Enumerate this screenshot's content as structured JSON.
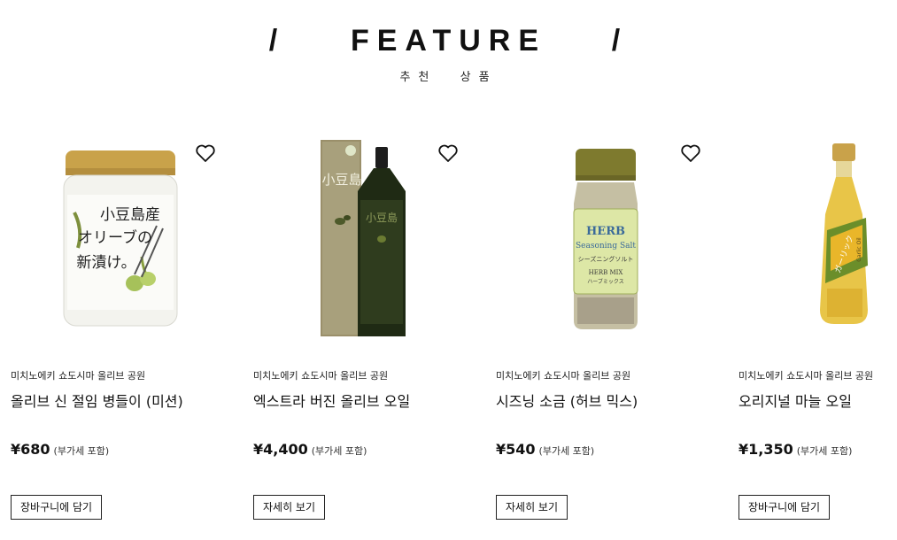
{
  "section": {
    "title": "/    FEATURE    /",
    "subtitle": "추천  상품"
  },
  "products": [
    {
      "brand": "미치노에키 쇼도시마 올리브 공원",
      "name": "올리브 신 절임 병들이 (미션)",
      "price": "¥680",
      "tax_note": "(부가세 포함)",
      "button": "장바구니에 담기",
      "image_icon": "olive-pickle-jar",
      "favorite_icon": "heart-icon"
    },
    {
      "brand": "미치노에키 쇼도시마 올리브 공원",
      "name": "엑스트라 버진 올리브 오일",
      "price": "¥4,400",
      "tax_note": "(부가세 포함)",
      "button": "자세히 보기",
      "image_icon": "olive-oil-bottle-with-box",
      "favorite_icon": "heart-icon"
    },
    {
      "brand": "미치노에키 쇼도시마 올리브 공원",
      "name": "시즈닝 소금 (허브 믹스)",
      "price": "¥540",
      "tax_note": "(부가세 포함)",
      "button": "자세히 보기",
      "image_icon": "herb-salt-shaker",
      "favorite_icon": "heart-icon"
    },
    {
      "brand": "미치노에키 쇼도시마 올리브 공원",
      "name": "오리지널 마늘 오일",
      "price": "¥1,350",
      "tax_note": "(부가세 포함)",
      "button": "장바구니에 담기",
      "image_icon": "garlic-oil-bottle",
      "favorite_icon": "heart-icon"
    }
  ],
  "images": {
    "jar_label": [
      "小豆島産",
      "オリーブの",
      "新漬け。"
    ],
    "box_label": "小豆島",
    "herb_label": [
      "HERB",
      "Seasoning Salt",
      "シーズニングソルト",
      "HERB MIX",
      "ハーブミックス"
    ],
    "garlic_label": "ガーリック",
    "garlic_side": "Garlic Oil"
  },
  "colors": {
    "text": "#111111",
    "border": "#222222",
    "olive": "#8a8a4c",
    "oil_dark": "#2c3a1f",
    "herb_cap": "#7e7a2e",
    "herb_label": "#dde7a6",
    "gold": "#c9a24a"
  }
}
